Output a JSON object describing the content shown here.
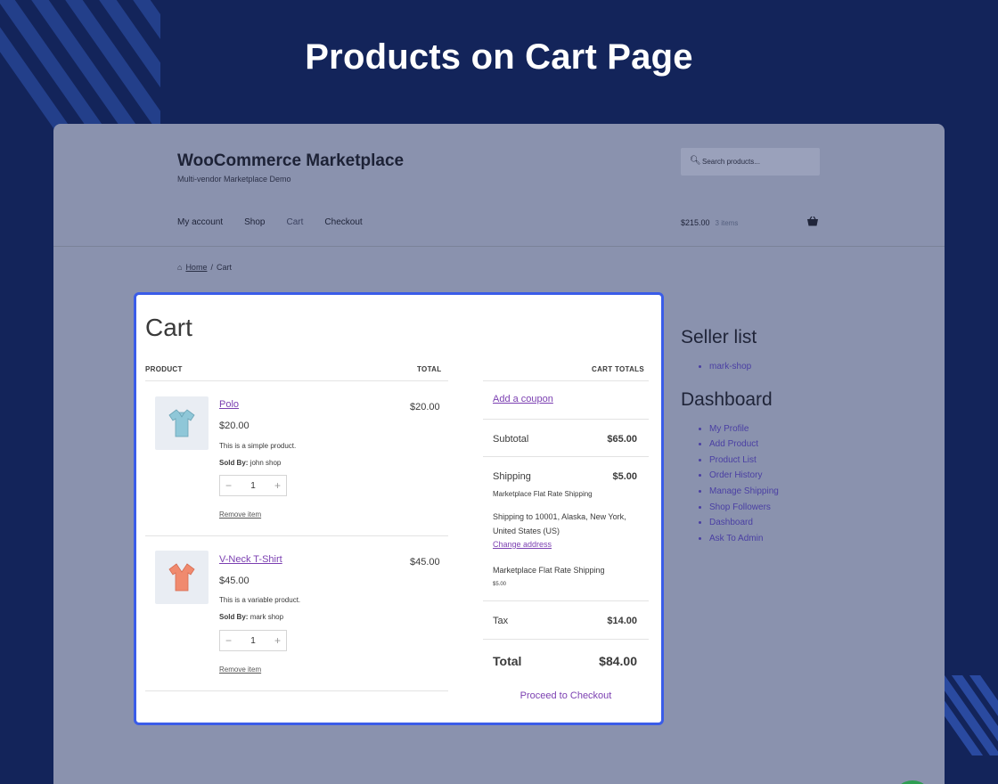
{
  "headline": "Products on Cart Page",
  "site": {
    "title": "WooCommerce Marketplace",
    "tagline": "Multi-vendor Marketplace Demo",
    "search_placeholder": "Search products..."
  },
  "nav": [
    "My account",
    "Shop",
    "Cart",
    "Checkout"
  ],
  "header_cart": {
    "amount": "$215.00",
    "items": "3 items"
  },
  "breadcrumb": {
    "home": "Home",
    "current": "Cart"
  },
  "cart": {
    "title": "Cart",
    "col_product": "PRODUCT",
    "col_total": "TOTAL",
    "items": [
      {
        "name": "Polo",
        "price": "$20.00",
        "description": "This is a simple product.",
        "sold_by_label": "Sold By:",
        "seller": "john shop",
        "qty": "1",
        "remove": "Remove item",
        "total": "$20.00",
        "color": "#8fc7d8"
      },
      {
        "name": "V-Neck T-Shirt",
        "price": "$45.00",
        "description": "This is a variable product.",
        "sold_by_label": "Sold By:",
        "seller": "mark shop",
        "qty": "1",
        "remove": "Remove item",
        "total": "$45.00",
        "color": "#f08a6e"
      }
    ]
  },
  "totals": {
    "heading": "CART TOTALS",
    "coupon": "Add a coupon",
    "subtotal_label": "Subtotal",
    "subtotal": "$65.00",
    "shipping_label": "Shipping",
    "shipping": "$5.00",
    "shipping_method": "Marketplace Flat Rate Shipping",
    "shipping_address": "Shipping to 10001, Alaska, New York, United States (US)",
    "change_address": "Change address",
    "vendor_method": "Marketplace Flat Rate Shipping",
    "vendor_amount": "$5.00",
    "tax_label": "Tax",
    "tax": "$14.00",
    "total_label": "Total",
    "total": "$84.00",
    "checkout": "Proceed to Checkout"
  },
  "sidebar": {
    "seller_heading": "Seller list",
    "sellers": [
      "mark-shop"
    ],
    "dashboard_heading": "Dashboard",
    "links": [
      "My Profile",
      "Add Product",
      "Product List",
      "Order History",
      "Manage Shipping",
      "Shop Followers",
      "Dashboard",
      "Ask To Admin"
    ]
  },
  "colors": {
    "background": "#13245a",
    "accent_border": "#3a5ce8",
    "link": "#7b3fb1"
  }
}
